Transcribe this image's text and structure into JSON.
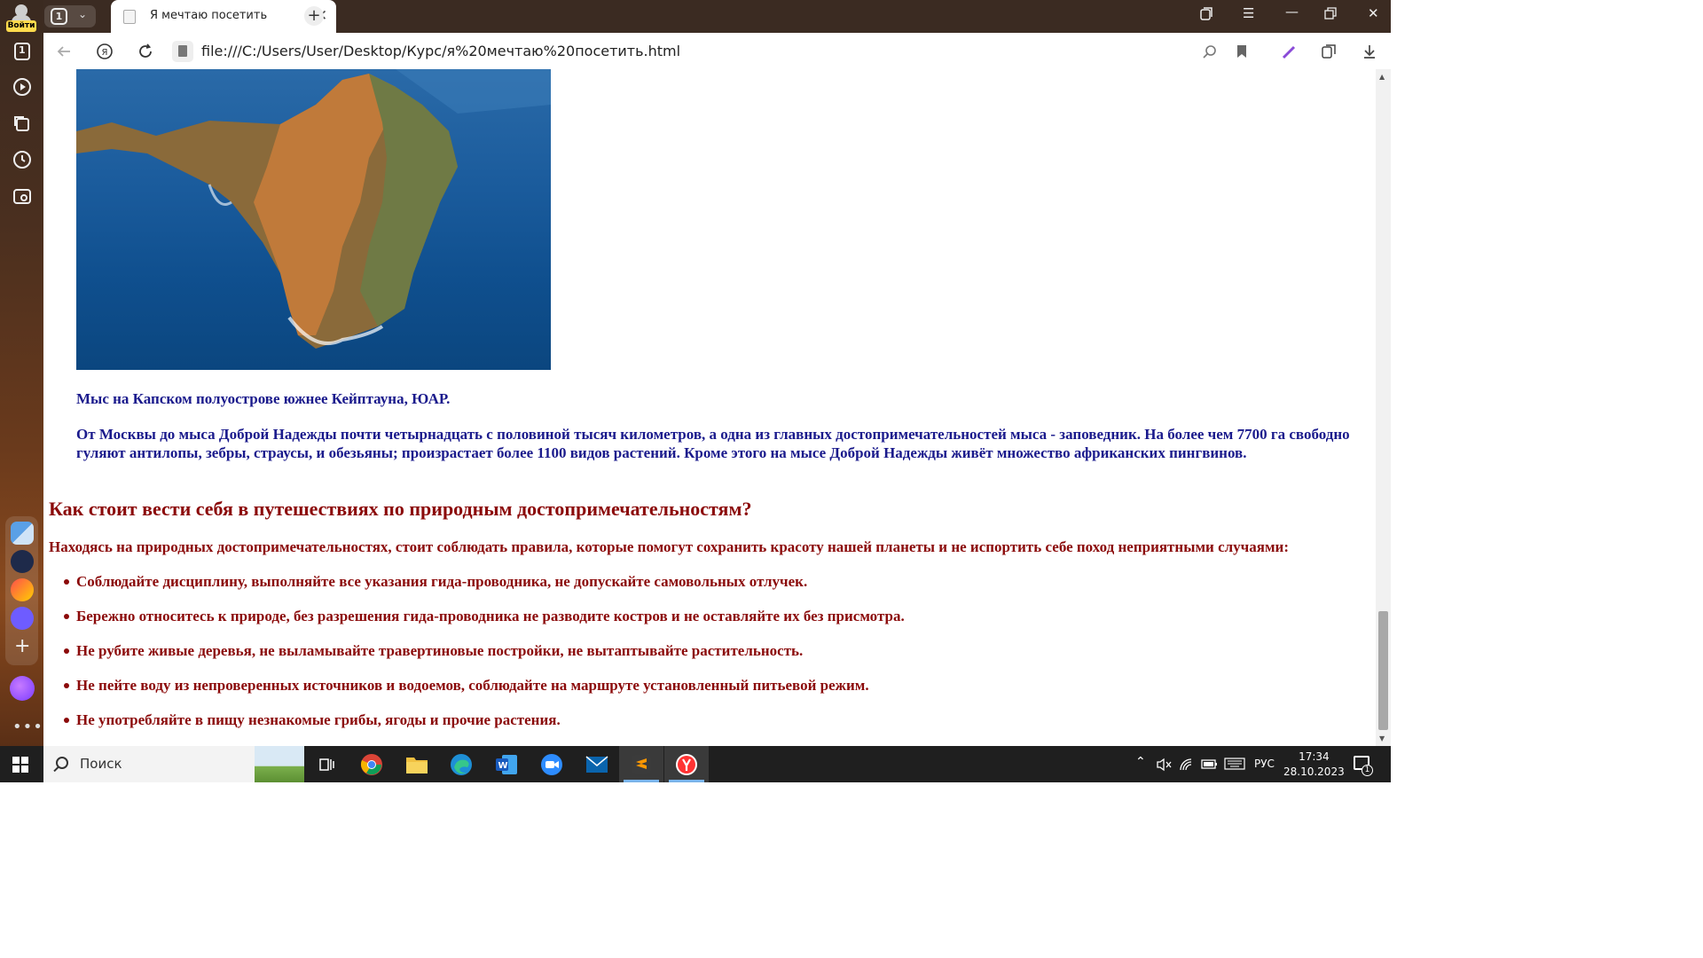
{
  "sidebar": {
    "login_label": "Войти",
    "tabs_count": "1"
  },
  "tabbar": {
    "tab_counter": "1",
    "active_tab_title": "Я мечтаю посетить"
  },
  "address": {
    "url": "file:///C:/Users/User/Desktop/Курс/я%20мечтаю%20посетить.html"
  },
  "page": {
    "caption": "Мыс на Капском полуострове южнее Кейптауна, ЮАР.",
    "paragraph": "От Москвы до мыса Доброй Надежды почти четырнадцать с половиной тысяч километров, а одна из главных достопримечательностей мыса - заповедник. На более чем 7700 га свободно гуляют антилопы, зебры, страусы, и обезьяны; произрастает более 1100 видов растений. Кроме этого на мысе Доброй Надежды живёт множество африканских пингвинов.",
    "heading": "Как стоит вести себя в путешествиях по природным достопримечательностям?",
    "intro": "Находясь на природных достопримечательностях, стоит соблюдать правила, которые помогут сохранить красоту нашей планеты и не испортить себе поход неприятными случаями:",
    "rules": [
      "Соблюдайте дисциплину, выполняйте все указания гида-проводника, не допускайте самовольных отлучек.",
      "Бережно относитесь к природе, без разрешения гида-проводника не разводите костров и не оставляйте их без присмотра.",
      "Не рубите живые деревья, не выламывайте травертиновые постройки, не вытаптывайте растительность.",
      "Не пейте воду из непроверенных источников и водоемов, соблюдайте на маршруте установленный питьевой режим.",
      "Не употребляйте в пищу незнакомые грибы, ягоды и прочие растения."
    ]
  },
  "taskbar": {
    "search_placeholder": "Поиск",
    "language": "РУС",
    "time": "17:34",
    "date": "28.10.2023",
    "notification_count": "1"
  },
  "icons": {
    "tab_favicon": "page-icon",
    "file_icon": "file-icon"
  },
  "colors": {
    "text_blue": "#1a1a8c",
    "text_red": "#8b0a0a",
    "yandex_yellow": "#ffdb4d"
  }
}
